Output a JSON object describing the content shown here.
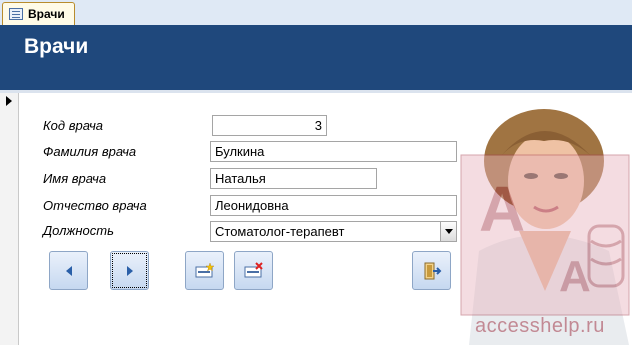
{
  "tab": {
    "label": "Врачи"
  },
  "header": {
    "title": "Врачи"
  },
  "form": {
    "fields": [
      {
        "label": "Код врача",
        "value": "3"
      },
      {
        "label": "Фамилия врача",
        "value": "Булкина"
      },
      {
        "label": "Имя врача",
        "value": "Наталья"
      },
      {
        "label": "Отчество врача",
        "value": "Леонидовна"
      },
      {
        "label": "Должность",
        "value": "Стоматолог-терапевт"
      }
    ]
  },
  "buttons": [
    {
      "name": "prev-record-button",
      "icon": "left-triangle-icon"
    },
    {
      "name": "next-record-button",
      "icon": "right-triangle-icon"
    },
    {
      "name": "new-record-button",
      "icon": "new-record-icon"
    },
    {
      "name": "delete-record-button",
      "icon": "delete-record-icon"
    },
    {
      "name": "close-form-button",
      "icon": "exit-door-icon"
    }
  ],
  "watermark": {
    "text": "accesshelp.ru"
  },
  "colors": {
    "header": "#1f487c",
    "accent_button": "#c6d8f0",
    "watermark": "#a33a4a"
  }
}
